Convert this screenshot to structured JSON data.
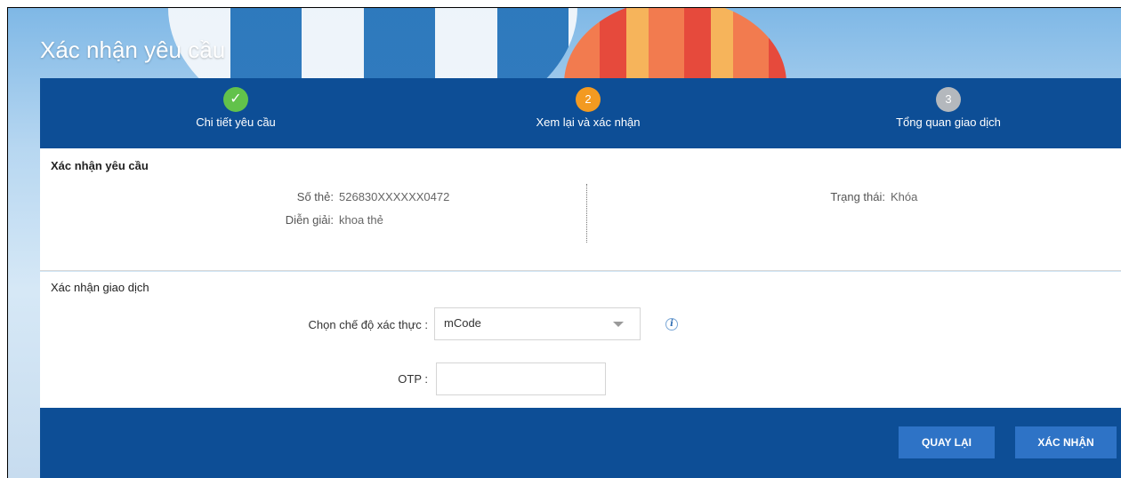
{
  "page": {
    "title": "Xác nhận yêu cầu"
  },
  "steps": [
    {
      "label": "Chi tiết yêu cầu",
      "badge": "✓",
      "state": "done"
    },
    {
      "label": "Xem lại và xác nhận",
      "badge": "2",
      "state": "current"
    },
    {
      "label": "Tổng quan giao dịch",
      "badge": "3",
      "state": "next"
    }
  ],
  "request": {
    "title": "Xác nhận yêu cầu",
    "card_label": "Số thẻ:",
    "card_value": "526830XXXXXX0472",
    "desc_label": "Diễn giải:",
    "desc_value": "khoa thẻ",
    "status_label": "Trạng thái:",
    "status_value": "Khóa"
  },
  "transaction": {
    "title": "Xác nhận giao dịch",
    "auth_label": "Chọn chế độ xác thực  :",
    "auth_value": "mCode",
    "otp_label": "OTP  :",
    "otp_value": ""
  },
  "footer": {
    "back_label": "QUAY LẠI",
    "confirm_label": "XÁC NHẬN"
  },
  "colors": {
    "primary": "#0d4e96",
    "button": "#2e73c6",
    "step_done": "#62c24b",
    "step_current": "#f39a21",
    "step_next": "#b4b8bd"
  },
  "icons": {
    "step_done": "checkmark-icon",
    "info": "info-icon",
    "select_caret": "chevron-down-icon"
  }
}
